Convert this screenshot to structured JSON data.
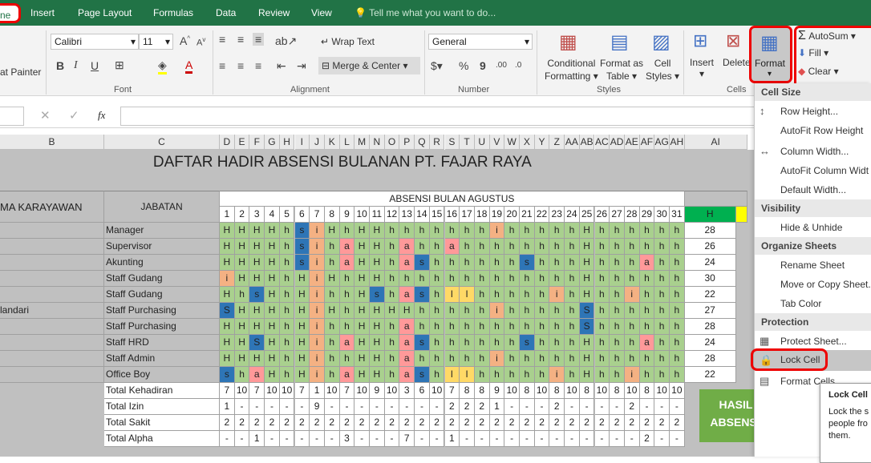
{
  "tabs": {
    "home": "ne",
    "insert": "Insert",
    "page_layout": "Page Layout",
    "formulas": "Formulas",
    "data": "Data",
    "review": "Review",
    "view": "View",
    "tell": "Tell me what you want to do..."
  },
  "ribbon": {
    "painter": "at Painter",
    "font_name": "Calibri",
    "font_size": "11",
    "font_group": "Font",
    "bold": "B",
    "italic": "I",
    "underline": "U",
    "wrap_text": "Wrap Text",
    "merge_center": "Merge & Center",
    "alignment_group": "Alignment",
    "number_format": "General",
    "percent": "%",
    "comma": "9",
    "number_group": "Number",
    "cond_format_1": "Conditional",
    "cond_format_2": "Formatting",
    "format_table_1": "Format as",
    "format_table_2": "Table",
    "cell_styles_1": "Cell",
    "cell_styles_2": "Styles",
    "styles_group": "Styles",
    "insert": "Insert",
    "delete": "Delete",
    "format": "Format",
    "cells_group": "Cells",
    "autosum": "AutoSum",
    "fill": "Fill",
    "clear": "Clear"
  },
  "formula_bar": {
    "fx": "fx",
    "value": ""
  },
  "sheet": {
    "col_b": "B",
    "col_c": "C",
    "col_ai": "AI",
    "day_cols": [
      "D",
      "E",
      "F",
      "G",
      "H",
      "I",
      "J",
      "K",
      "L",
      "M",
      "N",
      "O",
      "P",
      "Q",
      "R",
      "S",
      "T",
      "U",
      "V",
      "W",
      "X",
      "Y",
      "Z",
      "AA",
      "AB",
      "AC",
      "AD",
      "AE",
      "AF",
      "AG",
      "AH"
    ],
    "title": "DAFTAR HADIR ABSENSI BULANAN PT. FAJAR RAYA",
    "hdr_nama": "MA KARAYAWAN",
    "hdr_jabatan": "JABATAN",
    "hdr_absensi": "ABSENSI BULAN AGUSTUS",
    "hdr_h": "H",
    "days": [
      "1",
      "2",
      "3",
      "4",
      "5",
      "6",
      "7",
      "8",
      "9",
      "10",
      "11",
      "12",
      "13",
      "14",
      "15",
      "16",
      "17",
      "18",
      "19",
      "20",
      "21",
      "22",
      "23",
      "24",
      "25",
      "26",
      "27",
      "28",
      "29",
      "30",
      "31"
    ],
    "rows": [
      {
        "name": "",
        "jab": "Manager",
        "cells": "HHHHhsiHhHHhhhhhhhihhhhhHhhhhhh",
        "total": "28"
      },
      {
        "name": "",
        "jab": "Supervisor",
        "cells": "HHHHhsihaHHhahhahhhhhhhhHhhhhhh",
        "total": "26"
      },
      {
        "name": "",
        "jab": "Akunting",
        "cells": "HHHHhsihaHHhashhhhhhshhhHhhhahh",
        "total": "24"
      },
      {
        "name": "",
        "jab": "Staff Gudang",
        "cells": "iHHHhHiHhHHhhhhhhhhhhhhhHhhhhhh",
        "total": "30"
      },
      {
        "name": "",
        "jab": "Staff Gudang",
        "cells": "HhsHhHihhHshashllhhhhhihHhhihhh",
        "total": "22"
      },
      {
        "name": "landari",
        "jab": "Staff Purchasing",
        "cells": "SHHHhHiHhHHHHhhhhhihhhhhShhhhhh",
        "total": "27"
      },
      {
        "name": "",
        "jab": "Staff Purchasing",
        "cells": "HHHHhHihhHHhahhhhhhhhhhhShhhhhh",
        "total": "28"
      },
      {
        "name": "",
        "jab": "Staff HRD",
        "cells": "HHSHhHihaHHhashhhhhhshhhHhhhahh",
        "total": "24"
      },
      {
        "name": "",
        "jab": "Staff Admin",
        "cells": "HHHHhHihhHHhahhhhhihhhhhHhhhhhh",
        "total": "28"
      },
      {
        "name": "",
        "jab": "Office Boy",
        "cells": "shaHhHihaHHhashllhhhhhihHhhihhh",
        "total": "22"
      }
    ],
    "totals": [
      {
        "label": "Total Kehadiran",
        "vals": [
          "7",
          "10",
          "7",
          "10",
          "10",
          "7",
          "1",
          "10",
          "7",
          "10",
          "9",
          "10",
          "3",
          "6",
          "10",
          "7",
          "8",
          "8",
          "9",
          "10",
          "8",
          "10",
          "8",
          "10",
          "8",
          "10",
          "8",
          "10",
          "8",
          "10",
          "10"
        ]
      },
      {
        "label": "Total Izin",
        "vals": [
          "1",
          "-",
          "-",
          "-",
          "-",
          "-",
          "9",
          "-",
          "-",
          "-",
          "-",
          "-",
          "-",
          "-",
          "-",
          "2",
          "2",
          "2",
          "1",
          "-",
          "-",
          "-",
          "2",
          "-",
          "-",
          "-",
          "-",
          "2",
          "-",
          "-",
          "-"
        ]
      },
      {
        "label": "Total Sakit",
        "vals": [
          "2",
          "2",
          "2",
          "2",
          "2",
          "2",
          "2",
          "2",
          "2",
          "2",
          "2",
          "2",
          "2",
          "2",
          "2",
          "2",
          "2",
          "2",
          "2",
          "2",
          "2",
          "2",
          "2",
          "2",
          "2",
          "2",
          "2",
          "2",
          "2",
          "2",
          "2"
        ]
      },
      {
        "label": "Total Alpha",
        "vals": [
          "-",
          "-",
          "1",
          "-",
          "-",
          "-",
          "-",
          "-",
          "3",
          "-",
          "-",
          "-",
          "7",
          "-",
          "-",
          "1",
          "-",
          "-",
          "-",
          "-",
          "-",
          "-",
          "-",
          "-",
          "-",
          "-",
          "-",
          "-",
          "2",
          "-",
          "-"
        ]
      }
    ],
    "rekap_1": "HASIL REKAPIT",
    "rekap_2": "ABSENSI PERIODE"
  },
  "colors": {
    "H": "#a9d08e",
    "h": "#a9d08e",
    "s": "#2e75b6",
    "S": "#2e75b6",
    "i": "#f4b183",
    "a": "#ff9999",
    "l": "#ffd966",
    "accent": "#217346"
  },
  "menu": {
    "cell_size": "Cell Size",
    "row_height": "Row Height...",
    "autofit_row": "AutoFit Row Height",
    "col_width": "Column Width...",
    "autofit_col": "AutoFit Column Widt",
    "default_width": "Default Width...",
    "visibility": "Visibility",
    "hide_unhide": "Hide & Unhide",
    "organize": "Organize Sheets",
    "rename": "Rename Sheet",
    "move_copy": "Move or Copy Sheet...",
    "tab_color": "Tab Color",
    "protection": "Protection",
    "protect": "Protect Sheet...",
    "lock": "Lock Cell",
    "format_cells": "Format Cells..."
  },
  "tooltip": {
    "title": "Lock Cell",
    "body": "Lock the s people fro them."
  }
}
